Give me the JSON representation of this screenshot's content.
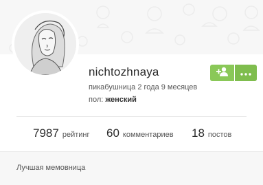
{
  "profile": {
    "username": "nichtozhnaya",
    "member_since": "пикабушница 2 года 9 месяцев",
    "gender_label": "пол:",
    "gender_value": "женский"
  },
  "actions": {
    "subscribe_icon": "add-user-icon",
    "more_icon": "more-dots-icon",
    "accent_color": "#8ac858"
  },
  "stats": {
    "rating_value": "7987",
    "rating_label": "рейтинг",
    "comments_value": "60",
    "comments_label": "комментариев",
    "posts_value": "18",
    "posts_label": "постов"
  },
  "footer": {
    "award_text": "Лучшая мемовница"
  }
}
